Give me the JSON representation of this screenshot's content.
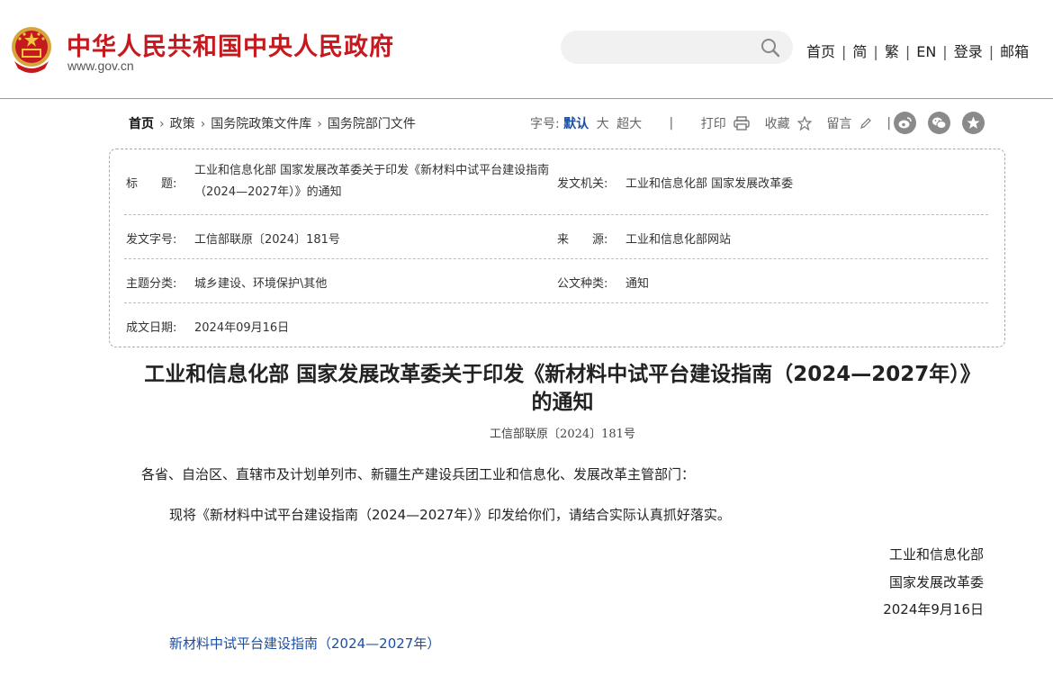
{
  "header": {
    "site_title": "中华人民共和国中央人民政府",
    "site_url": "www.gov.cn",
    "search_placeholder": "",
    "nav": [
      "首页",
      "简",
      "繁",
      "EN",
      "登录",
      "邮箱"
    ],
    "brand_color": "#c41a1f"
  },
  "breadcrumb": [
    "首页",
    "政策",
    "国务院政策文件库",
    "国务院部门文件"
  ],
  "tools": {
    "font_label": "字号:",
    "font_sizes": [
      "默认",
      "大",
      "超大"
    ],
    "print": "打印",
    "favorite": "收藏",
    "comment": "留言",
    "social_icons": [
      "weibo-icon",
      "wechat-icon",
      "star-share-icon"
    ]
  },
  "info": {
    "title_label": "标　　题:",
    "title_value": "工业和信息化部 国家发展改革委关于印发《新材料中试平台建设指南（2024—2027年）》的通知",
    "issuer_label": "发文机关:",
    "issuer_value": "工业和信息化部 国家发展改革委",
    "docno_label": "发文字号:",
    "docno_value": "工信部联原〔2024〕181号",
    "source_label": "来　　源:",
    "source_value": "工业和信息化部网站",
    "topic_label": "主题分类:",
    "topic_value": "城乡建设、环境保护\\其他",
    "doctype_label": "公文种类:",
    "doctype_value": "通知",
    "date_label": "成文日期:",
    "date_value": "2024年09月16日"
  },
  "article": {
    "title": "工业和信息化部 国家发展改革委关于印发《新材料中试平台建设指南（2024—2027年）》的通知",
    "doc_no": "工信部联原〔2024〕181号",
    "salutation": "各省、自治区、直辖市及计划单列市、新疆生产建设兵团工业和信息化、发展改革主管部门：",
    "body": "现将《新材料中试平台建设指南（2024—2027年）》印发给你们，请结合实际认真抓好落实。",
    "sign_1": "工业和信息化部",
    "sign_2": "国家发展改革委",
    "sign_date": "2024年9月16日",
    "attachment": "新材料中试平台建设指南（2024—2027年）",
    "link_color": "#1a4fa3"
  }
}
